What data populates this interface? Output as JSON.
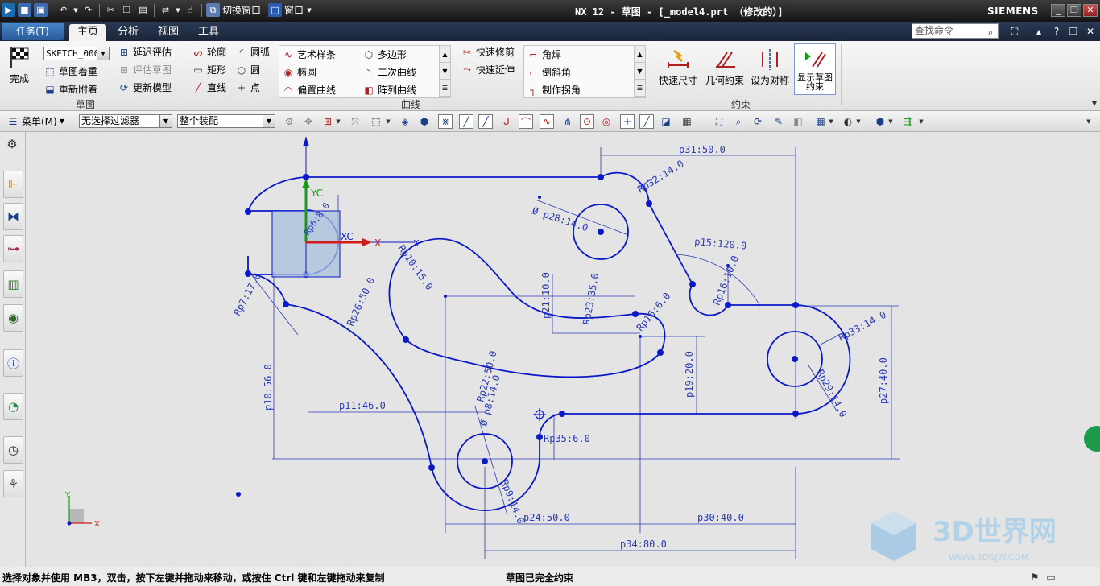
{
  "window": {
    "title": "NX 12 - 草图 - [_model4.prt （修改的）]",
    "brand": "SIEMENS",
    "quick_access": {
      "switch_window": "切换窗口",
      "window": "窗口"
    }
  },
  "menubar": {
    "task_label": "任务(T)",
    "tabs": [
      {
        "label": "主页",
        "active": true
      },
      {
        "label": "分析",
        "active": false
      },
      {
        "label": "视图",
        "active": false
      },
      {
        "label": "工具",
        "active": false
      }
    ],
    "search_placeholder": "查找命令"
  },
  "ribbon": {
    "sketch_group": {
      "label": "草图",
      "finish": "完成",
      "sketch_name": "SKETCH_000",
      "reorient": "草图着重",
      "reattach": "重新附着",
      "delay_eval": "延迟评估",
      "eval_sketch": "评估草图",
      "update_model": "更新模型"
    },
    "curve_group": {
      "label": "曲线",
      "profile": "轮廓",
      "arc": "圆弧",
      "rectangle": "矩形",
      "circle": "圆",
      "line": "直线",
      "point": "点",
      "gallery1": [
        "艺术样条",
        "椭圆",
        "偏置曲线"
      ],
      "gallery2": [
        "多边形",
        "二次曲线",
        "阵列曲线"
      ],
      "quick_trim": "快速修剪",
      "quick_extend": "快速延伸",
      "gallery3": [
        "角焊",
        "倒斜角",
        "制作拐角"
      ]
    },
    "constraint_group": {
      "label": "约束",
      "rapid_dim": "快速尺寸",
      "geo_constraint": "几何约束",
      "make_symmetric": "设为对称",
      "show_constraints": "显示草图约束"
    }
  },
  "toolbar2": {
    "menu_label": "菜单(M)",
    "filter": "无选择过滤器",
    "assembly": "整个装配"
  },
  "sketch": {
    "axis_labels": {
      "yc": "YC",
      "xc": "XC",
      "x": "X",
      "y": "Y"
    },
    "dimensions": [
      "p31:50.0",
      "Rp32:14.0",
      "Ø p28:14.0",
      "Rp6:8.0",
      "Rp10:15.0",
      "p15:120.0",
      "Rp16:10.0",
      "Rp7:17.0",
      "Rp26:50.0",
      "p21:10.0",
      "Rp23:35.0",
      "Rp16:6.0",
      "Rp33:14.0",
      "Rp29:14.0",
      "p27:40.0",
      "p19:20.0",
      "Rp22:50.0",
      "Ø p8:14.0",
      "p10:56.0",
      "p11:46.0",
      "Rp35:6.0",
      "Rp9:14.0",
      "p24:50.0",
      "p30:40.0",
      "p34:80.0"
    ]
  },
  "status": {
    "prompt": "选择对象并使用 MB3，双击，按下左键并拖动来移动，或按住 Ctrl 键和左键拖动来复制",
    "state": "草图已完全约束"
  },
  "watermark": {
    "text": "3D世界网",
    "url": "WWW.3DSJW.COM"
  },
  "colors": {
    "sketch_blue": "#0a18c8",
    "dimension_blue": "#2a3ab8",
    "canvas_bg": "#e4e4e4",
    "datum_green": "#1a9a1a",
    "datum_red": "#d41a1a"
  }
}
